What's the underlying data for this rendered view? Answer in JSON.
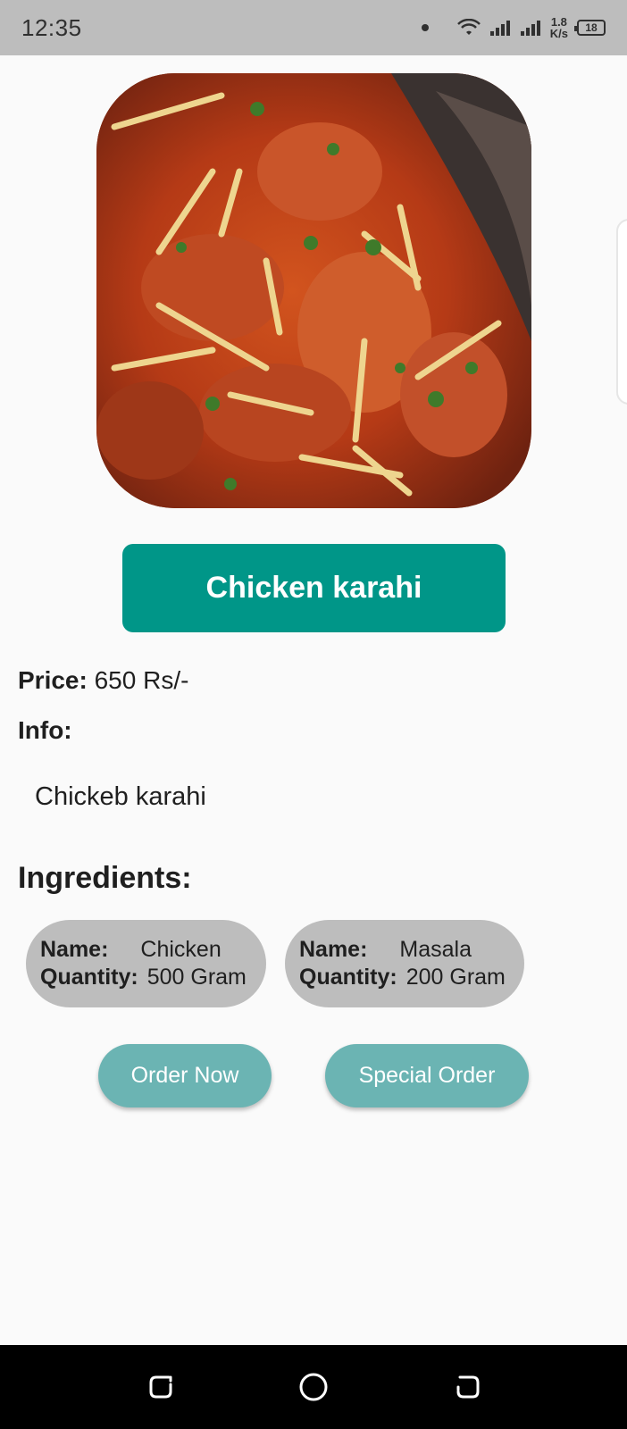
{
  "status_bar": {
    "time": "12:35",
    "network_speed_value": "1.8",
    "network_speed_unit": "K/s",
    "battery": "18",
    "icons": [
      "notification-dot",
      "wifi-icon",
      "signal-icon",
      "signal-icon",
      "battery-icon"
    ]
  },
  "dish": {
    "image_description_icon": "chicken-karahi-photo",
    "name": "Chicken karahi",
    "price_label": "Price:",
    "price_value": "650 Rs/-",
    "info_label": "Info:",
    "info_text": "Chickeb karahi"
  },
  "ingredients": {
    "title": "Ingredients:",
    "name_key": "Name:",
    "quantity_key": "Quantity:",
    "items": [
      {
        "name": "Chicken",
        "quantity": "500 Gram"
      },
      {
        "name": "Masala",
        "quantity": "200 Gram"
      }
    ]
  },
  "actions": {
    "order_now": "Order Now",
    "special_order": "Special Order"
  },
  "colors": {
    "primary": "#009688",
    "action_button": "#6bb4b3",
    "chip_background": "#bdbdbd",
    "status_bar": "#bdbdbd",
    "background": "#fafafa"
  }
}
